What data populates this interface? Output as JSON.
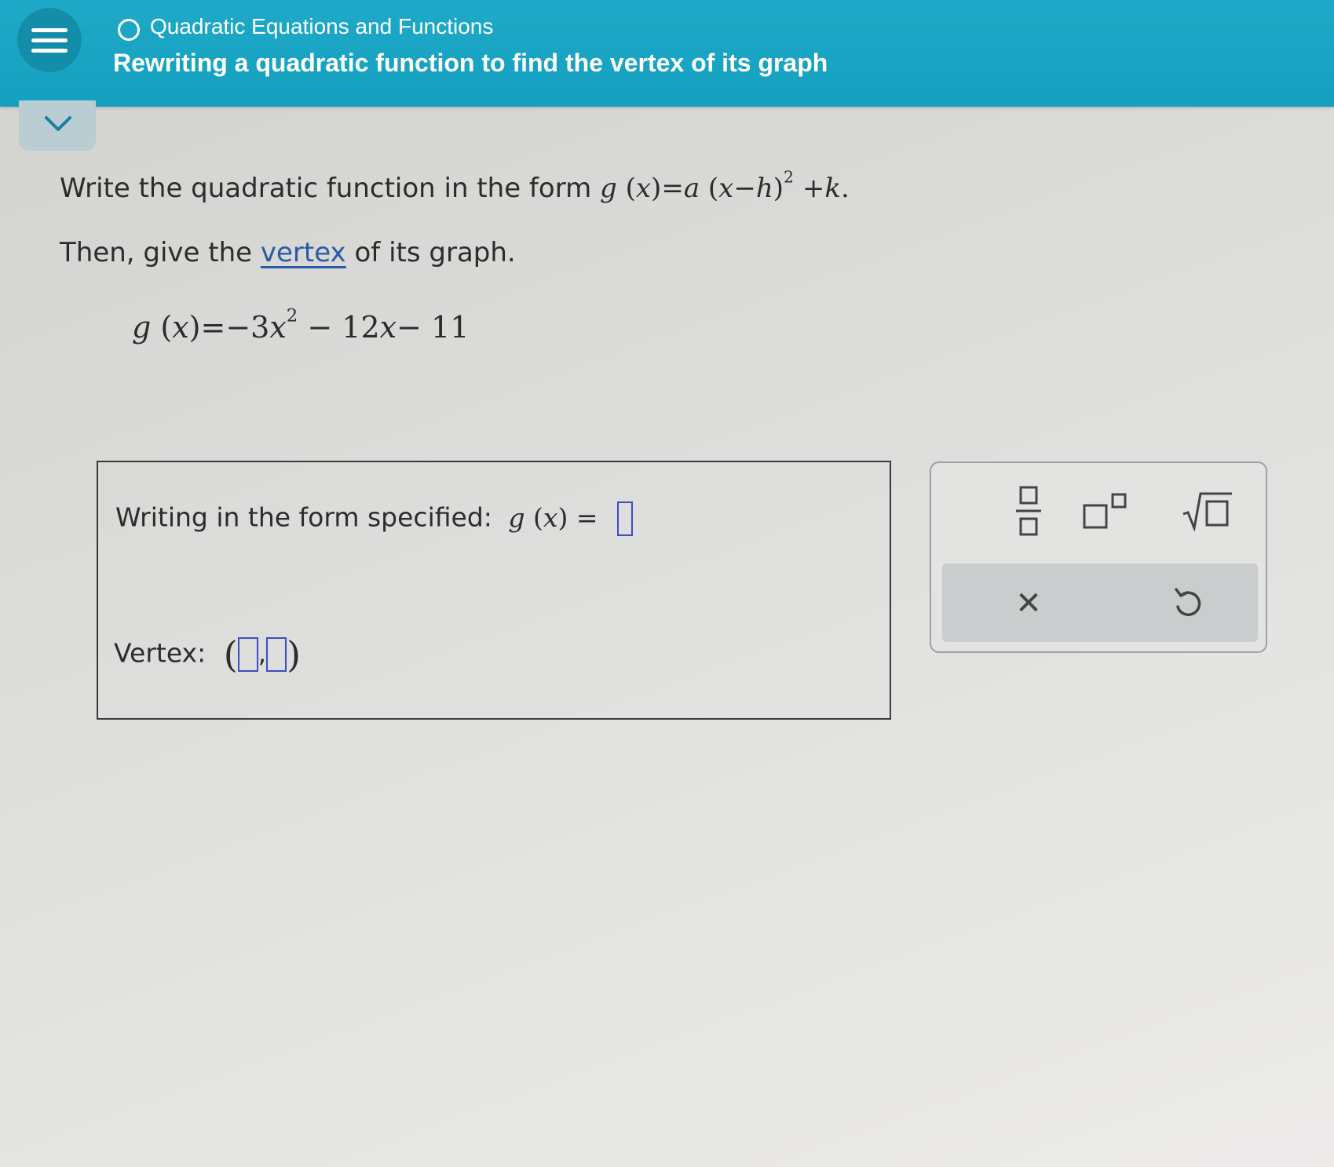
{
  "header": {
    "topic": "Quadratic Equations and Functions",
    "subtitle": "Rewriting a quadratic function to find the vertex of its graph"
  },
  "problem": {
    "instruction_prefix": "Write the quadratic function in the form",
    "form_g": "g",
    "form_x": "x",
    "form_eq": "=",
    "form_a": "a",
    "form_x2": "x",
    "form_minus": "−",
    "form_h": "h",
    "form_exp": "2",
    "form_plus": "+",
    "form_k": "k",
    "form_period": ".",
    "then_prefix": "Then, give the",
    "vertex_link": "vertex",
    "then_suffix": "of its graph.",
    "eq_g": "g",
    "eq_x": "x",
    "eq_rhs_a": "=−3",
    "eq_x2": "x",
    "eq_exp": "2",
    "eq_rhs_b": " − 12",
    "eq_x3": "x",
    "eq_rhs_c": "− 11"
  },
  "answer": {
    "form_label": "Writing in the form specified:",
    "form_g": "g",
    "form_x": "x",
    "form_eq": "=",
    "vertex_label": "Vertex:",
    "comma": ","
  },
  "toolbox": {
    "icons": [
      "fraction-icon",
      "exponent-icon",
      "sqrt-icon",
      "clear-icon",
      "undo-icon"
    ],
    "clear_glyph": "✕"
  }
}
